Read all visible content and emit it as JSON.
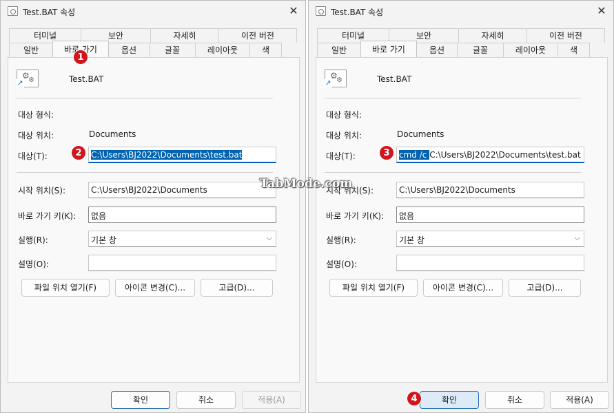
{
  "left": {
    "title": "Test.BAT 속성",
    "tabs_top": [
      "터미널",
      "보안",
      "자세히",
      "이전 버전"
    ],
    "tabs_bottom": [
      "일반",
      "바로 가기",
      "옵션",
      "글꼴",
      "레이아웃",
      "색"
    ],
    "active_tab": "바로 가기",
    "file_name": "Test.BAT",
    "target_type_label": "대상 형식:",
    "target_type_value": "",
    "target_location_label": "대상 위치:",
    "target_location_value": "Documents",
    "target_label": "대상(T):",
    "target_value": "C:\\Users\\BJ2022\\Documents\\test.bat",
    "start_in_label": "시작 위치(S):",
    "start_in_value": "C:\\Users\\BJ2022\\Documents",
    "shortcut_key_label": "바로 가기 키(K):",
    "shortcut_key_value": "없음",
    "run_label": "실행(R):",
    "run_value": "기본 창",
    "comment_label": "설명(O):",
    "comment_value": "",
    "open_location_button": "파일 위치 열기(F)",
    "change_icon_button": "아이콘 변경(C)...",
    "advanced_button": "고급(D)...",
    "ok_button": "확인",
    "cancel_button": "취소",
    "apply_button": "적용(A)"
  },
  "right": {
    "title": "Test.BAT 속성",
    "tabs_top": [
      "터미널",
      "보안",
      "자세히",
      "이전 버전"
    ],
    "tabs_bottom": [
      "일반",
      "바로 가기",
      "옵션",
      "글꼴",
      "레이아웃",
      "색"
    ],
    "active_tab": "바로 가기",
    "file_name": "Test.BAT",
    "target_type_label": "대상 형식:",
    "target_type_value": "",
    "target_location_label": "대상 위치:",
    "target_location_value": "Documents",
    "target_label": "대상(T):",
    "target_prefix_value": "cmd /c ",
    "target_value": "C:\\Users\\BJ2022\\Documents\\test.bat",
    "start_in_label": "시작 위치(S):",
    "start_in_value": "C:\\Users\\BJ2022\\Documents",
    "shortcut_key_label": "바로 가기 키(K):",
    "shortcut_key_value": "없음",
    "run_label": "실행(R):",
    "run_value": "기본 창",
    "comment_label": "설명(O):",
    "comment_value": "",
    "open_location_button": "파일 위치 열기(F)",
    "change_icon_button": "아이콘 변경(C)...",
    "advanced_button": "고급(D)...",
    "ok_button": "확인",
    "cancel_button": "취소",
    "apply_button": "적용(A)"
  },
  "annotations": {
    "step1": "1",
    "step2": "2",
    "step3": "3",
    "step4": "4"
  },
  "watermark": "TabMode.com",
  "colors": {
    "selection": "#0063b1",
    "badge": "#d0161d",
    "focus": "#005fb8"
  }
}
